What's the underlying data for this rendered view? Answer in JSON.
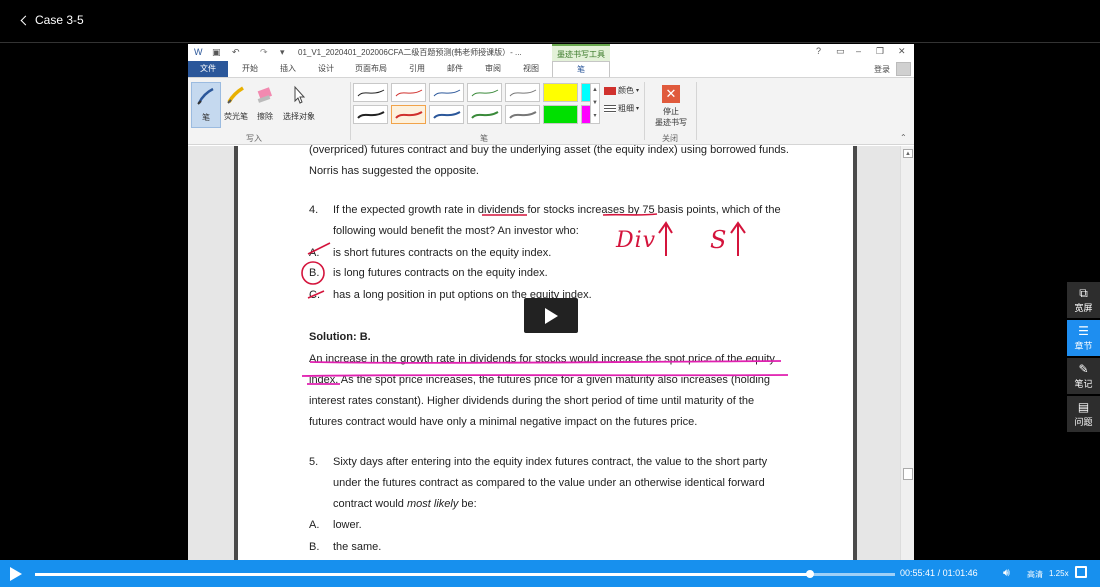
{
  "header": {
    "back_label": "Case 3-5"
  },
  "word": {
    "doc_title": "01_V1_2020401_202006CFA二级百题预测(韩老师授课版）- ...",
    "ink_tools_label": "墨迹书写工具",
    "window_controls": [
      "?",
      "▭",
      "–",
      "❐",
      "✕"
    ],
    "tabs": [
      "文件",
      "开始",
      "插入",
      "设计",
      "页面布局",
      "引用",
      "邮件",
      "审阅",
      "视图",
      "笔"
    ],
    "login_label": "登录",
    "ribbon": {
      "write_group": {
        "label": "写入",
        "buttons": [
          "笔",
          "荧光笔",
          "擦除",
          "选择对象"
        ]
      },
      "pen_group_label": "笔",
      "color_label": "颜色",
      "weight_label": "粗细",
      "close_group": {
        "label": "关闭",
        "stop_line1": "停止",
        "stop_line2": "墨迹书写"
      }
    }
  },
  "document": {
    "lines": {
      "l1": "(overpriced) futures contract and buy the underlying asset (the equity index) using borrowed funds.",
      "l2": "Norris has suggested the opposite.",
      "q4_num": "4.",
      "q4_a": "If the expected growth rate in dividends for stocks increases by 75 basis points, which of the",
      "q4_b": "following would benefit the most? An investor who:",
      "optA_letter": "A.",
      "optA": "is short futures contracts on the equity index.",
      "optB_letter": "B.",
      "optB": "is long futures contracts on the equity index.",
      "optC_letter": "C.",
      "optC": "has a long position in put options on the equity index.",
      "solution": "Solution: B.",
      "s1": "An increase in the growth rate in dividends for stocks would increase the spot price of the equity",
      "s2": "index. As the spot price increases, the futures price for a given maturity also increases (holding",
      "s3": "interest rates constant). Higher dividends during the short period of time until maturity of the",
      "s4": "futures contract would have only a minimal negative impact on the futures price.",
      "q5_num": "5.",
      "q5_a": "Sixty days after entering into the equity index futures contract, the value to the short party",
      "q5_b": "under the futures contract as compared to the value under an otherwise identical forward",
      "q5_c_pre": "contract would ",
      "q5_c_em": "most likely",
      "q5_c_post": " be:",
      "q5_optA_letter": "A.",
      "q5_optA": "lower.",
      "q5_optB_letter": "B.",
      "q5_optB": "the same."
    },
    "handwriting": {
      "div_note": "Div",
      "st_note": "S"
    }
  },
  "side_panel": [
    {
      "label": "宽屏",
      "icon": "widescreen-icon",
      "active": false
    },
    {
      "label": "章节",
      "icon": "chapters-icon",
      "active": true
    },
    {
      "label": "笔记",
      "icon": "notes-icon",
      "active": false
    },
    {
      "label": "问题",
      "icon": "questions-icon",
      "active": false
    }
  ],
  "player": {
    "current_time": "00:55:41",
    "separator": "/",
    "total_time": "01:01:46",
    "progress_fraction": 0.9015,
    "quality": "高清",
    "speed": "1.25x"
  }
}
